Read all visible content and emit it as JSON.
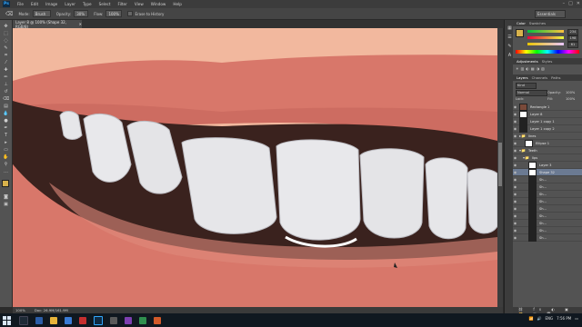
{
  "app": {
    "name": "Ps"
  },
  "menu": [
    "File",
    "Edit",
    "Image",
    "Layer",
    "Type",
    "Select",
    "Filter",
    "View",
    "Window",
    "Help"
  ],
  "options_bar": {
    "mode_label": "Mode:",
    "mode_value": "Brush",
    "opacity_label": "Opacity:",
    "opacity_value": "30%",
    "flow_label": "Flow:",
    "flow_value": "100%",
    "erase_history_label": "Erase to History",
    "workspace": "Essentials"
  },
  "document": {
    "tab_title": "Layer 8 @ 100% (Shape 32, RGB/8)",
    "zoom": "100%",
    "doc_info": "Doc: 26.9M/161.9M"
  },
  "panels": {
    "color_tabs": [
      "Color",
      "Swatches"
    ],
    "adjust_tabs": [
      "Adjustments",
      "Styles"
    ],
    "layer_tabs": [
      "Layers",
      "Channels",
      "Paths"
    ],
    "kind_label": "Kind",
    "blend_mode": "Normal",
    "opacity_label": "Opacity:",
    "opacity_value": "100%",
    "lock_label": "Lock:",
    "fill_label": "Fill:",
    "fill_value": "100%",
    "slider_values": [
      "234",
      "198",
      "61"
    ],
    "layers": [
      {
        "name": "Rectangle 1"
      },
      {
        "name": "Layer 8"
      },
      {
        "name": "Layer 1 copy 1"
      },
      {
        "name": "Layer 1 copy 2"
      },
      {
        "name": "lines"
      },
      {
        "name": "Ellipse 1"
      },
      {
        "name": "Teeth"
      },
      {
        "name": "lips"
      },
      {
        "name": "Layer 3"
      },
      {
        "name": "Shape 32"
      },
      {
        "name": "Sh..."
      },
      {
        "name": "Sh..."
      },
      {
        "name": "Sh..."
      },
      {
        "name": "Sh..."
      },
      {
        "name": "Sh..."
      },
      {
        "name": "Sh..."
      },
      {
        "name": "Sh..."
      },
      {
        "name": "Sh..."
      },
      {
        "name": "Sh..."
      }
    ]
  },
  "taskbar": {
    "time": "7:56 PM",
    "lang": "ENG"
  },
  "colors": {
    "canvas_bg": "#f2b89e",
    "lip": "#d8776a",
    "lip_shadow": "#c4645a",
    "mouth_dark": "#3a221e",
    "tooth": "#e6e6e9",
    "tooth_edge": "#bcbcc2",
    "selected_layer": "#6b7a92"
  }
}
